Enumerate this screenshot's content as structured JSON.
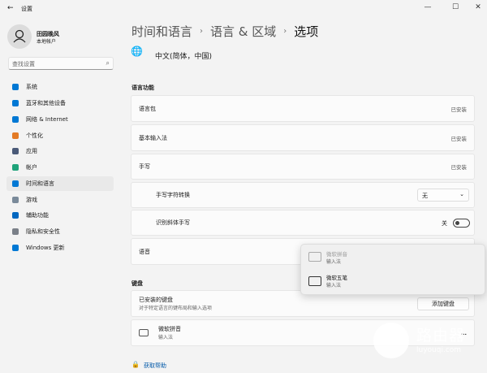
{
  "window": {
    "title": "设置",
    "back_icon": "arrow-left-icon",
    "controls": [
      "minimize",
      "maximize",
      "close"
    ]
  },
  "user": {
    "name": "田园晚风",
    "account": "本地帐户"
  },
  "search": {
    "placeholder": "查找设置"
  },
  "sidebar": {
    "items": [
      {
        "label": "系统",
        "icon": "monitor-icon",
        "color": "#0078d4"
      },
      {
        "label": "蓝牙和其他设备",
        "icon": "bluetooth-icon",
        "color": "#0078d4"
      },
      {
        "label": "网络 & Internet",
        "icon": "wifi-icon",
        "color": "#0078d4"
      },
      {
        "label": "个性化",
        "icon": "brush-icon",
        "color": "#e37a25"
      },
      {
        "label": "应用",
        "icon": "apps-icon",
        "color": "#4a5a78"
      },
      {
        "label": "帐户",
        "icon": "person-icon",
        "color": "#1fa37a"
      },
      {
        "label": "时间和语言",
        "icon": "globe-clock-icon",
        "color": "#0078d4",
        "selected": true
      },
      {
        "label": "游戏",
        "icon": "gamepad-icon",
        "color": "#7a8a9a"
      },
      {
        "label": "辅助功能",
        "icon": "accessibility-icon",
        "color": "#0067c0"
      },
      {
        "label": "隐私和安全性",
        "icon": "shield-icon",
        "color": "#7a8088"
      },
      {
        "label": "Windows 更新",
        "icon": "update-icon",
        "color": "#0078d4"
      }
    ]
  },
  "breadcrumb": [
    "时间和语言",
    "语言 & 区域",
    "选项"
  ],
  "language": {
    "name": "中文(简体，中国)",
    "icon": "language-icon"
  },
  "features": {
    "title": "语言功能",
    "rows": [
      {
        "label": "语言包",
        "status": "已安装"
      },
      {
        "label": "基本输入法",
        "status": "已安装"
      },
      {
        "label": "手写",
        "status": "已安装"
      },
      {
        "label": "手写字符转换",
        "value": "无"
      },
      {
        "label": "识别斜体手写",
        "toggle_label": "关",
        "toggle_on": false
      },
      {
        "label": "语音"
      }
    ]
  },
  "popup": {
    "items": [
      {
        "name": "微软拼音",
        "sub": "输入法",
        "disabled": true
      },
      {
        "name": "微软五笔",
        "sub": "输入法",
        "disabled": false
      }
    ]
  },
  "keyboard": {
    "title": "键盘",
    "installed_title": "已安装的键盘",
    "installed_desc": "对于特定语言的键布局和输入选项",
    "add_button": "添加键盘",
    "items": [
      {
        "name": "微软拼音",
        "sub": "输入法",
        "more": "..."
      }
    ]
  },
  "help": {
    "label": "获取帮助"
  },
  "watermark": {
    "text": "路由器",
    "url": "luyouqi.com"
  }
}
